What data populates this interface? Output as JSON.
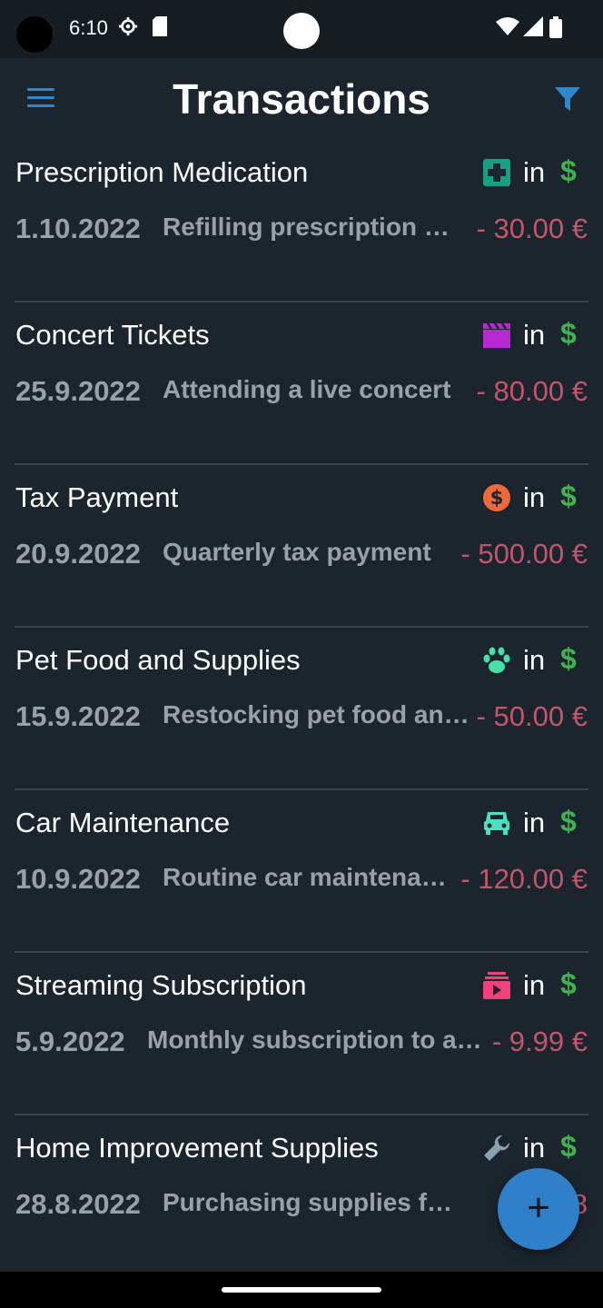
{
  "status_bar": {
    "time": "6:10"
  },
  "app_bar": {
    "title": "Transactions"
  },
  "transactions": [
    {
      "name": "Prescription Medication",
      "category_icon": "medical-cross-icon",
      "category_color": "#18a085",
      "in_label": "in",
      "currency_symbol": "$",
      "date": "1.10.2022",
      "description": "Refilling prescription me…",
      "amount": "- 30.00 €"
    },
    {
      "name": "Concert Tickets",
      "category_icon": "clapperboard-icon",
      "category_color": "#b62ad1",
      "in_label": "in",
      "currency_symbol": "$",
      "date": "25.9.2022",
      "description": "Attending a live concert",
      "amount": "- 80.00 €"
    },
    {
      "name": "Tax Payment",
      "category_icon": "dollar-circle-icon",
      "category_color": "#ee6a3c",
      "in_label": "in",
      "currency_symbol": "$",
      "date": "20.9.2022",
      "description": "Quarterly tax payment",
      "amount": "- 500.00 €"
    },
    {
      "name": "Pet Food and Supplies",
      "category_icon": "paw-icon",
      "category_color": "#46e0a8",
      "in_label": "in",
      "currency_symbol": "$",
      "date": "15.9.2022",
      "description": "Restocking pet food and…",
      "amount": "- 50.00 €"
    },
    {
      "name": "Car Maintenance",
      "category_icon": "car-icon",
      "category_color": "#4ae0c0",
      "in_label": "in",
      "currency_symbol": "$",
      "date": "10.9.2022",
      "description": "Routine car maintenan…",
      "amount": "- 120.00 €"
    },
    {
      "name": "Streaming Subscription",
      "category_icon": "subscriptions-icon",
      "category_color": "#f0417a",
      "in_label": "in",
      "currency_symbol": "$",
      "date": "5.9.2022",
      "description": "Monthly subscription to a s…",
      "amount": "- 9.99 €"
    },
    {
      "name": "Home Improvement Supplies",
      "category_icon": "wrench-icon",
      "category_color": "#8aa0b0",
      "in_label": "in",
      "currency_symbol": "$",
      "date": "28.8.2022",
      "description": "Purchasing supplies for …",
      "amount": "- 8"
    }
  ],
  "fab": {
    "label": "+"
  },
  "colors": {
    "accent": "#2f86c8",
    "background": "#1c252e",
    "amount": "#c2566b",
    "currency": "#3fb34f"
  }
}
